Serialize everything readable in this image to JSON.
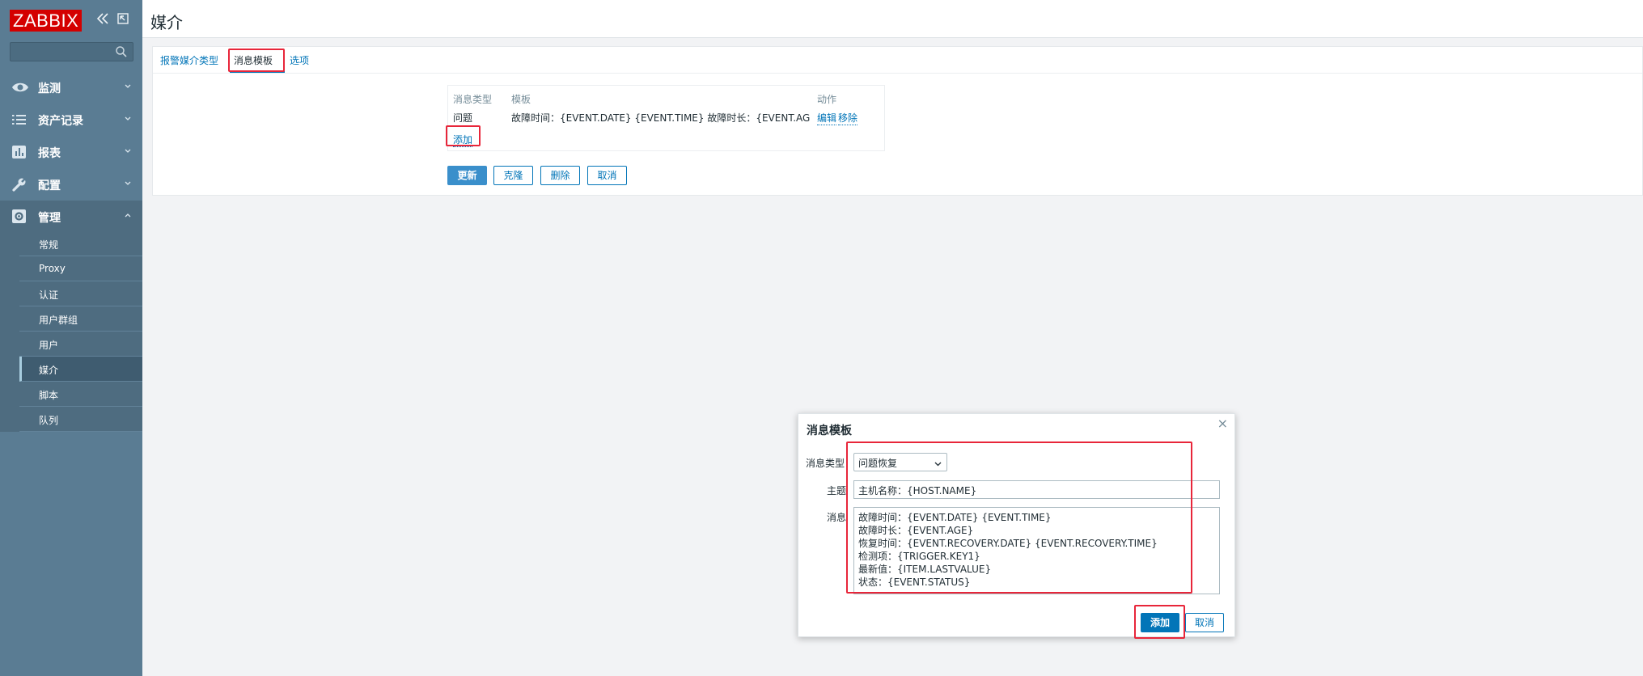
{
  "sidebar": {
    "logo": "ZABBIX",
    "collapse_icon": "double-chevron-left-icon",
    "kiosk_icon": "kiosk-icon",
    "search": {
      "placeholder": "",
      "value": ""
    },
    "menu": [
      {
        "label": "监测",
        "icon": "eye-icon"
      },
      {
        "label": "资产记录",
        "icon": "list-icon"
      },
      {
        "label": "报表",
        "icon": "bar-chart-icon"
      },
      {
        "label": "配置",
        "icon": "wrench-icon"
      },
      {
        "label": "管理",
        "icon": "gear-icon"
      }
    ],
    "admin_submenu": [
      "常规",
      "Proxy",
      "认证",
      "用户群组",
      "用户",
      "媒介",
      "脚本",
      "队列"
    ],
    "selected_submenu": "媒介"
  },
  "header": {
    "title": "媒介"
  },
  "tabs": [
    "报警媒介类型",
    "消息模板",
    "选项"
  ],
  "templates_table": {
    "headers": [
      "消息类型",
      "模板",
      "动作"
    ],
    "rows": [
      {
        "type": "问题",
        "template": "故障时间：{EVENT.DATE} {EVENT.TIME} 故障时长：{EVENT.AGE}…",
        "edit": "编辑",
        "remove": "移除"
      }
    ],
    "add_label": "添加"
  },
  "form_buttons": {
    "update": "更新",
    "clone": "克隆",
    "delete": "删除",
    "cancel": "取消"
  },
  "dialog": {
    "title": "消息模板",
    "close_icon": "close-icon",
    "type_label": "消息类型",
    "type_value": "问题恢复",
    "subject_label": "主题",
    "subject_value": "主机名称：{HOST.NAME}",
    "message_label": "消息",
    "message_lines": [
      "故障时间：{EVENT.DATE} {EVENT.TIME}",
      "故障时长：{EVENT.AGE}",
      "恢复时间：{EVENT.RECOVERY.DATE} {EVENT.RECOVERY.TIME}",
      "检测项：{TRIGGER.KEY1}",
      "最新值：{ITEM.LASTVALUE}",
      "状态：{EVENT.STATUS}"
    ],
    "add_button": "添加",
    "cancel_button": "取消"
  },
  "colors": {
    "sidebar": "#5a7c93",
    "accent": "#0275b8",
    "highlight": "#e8263a",
    "logo": "#d40000"
  }
}
